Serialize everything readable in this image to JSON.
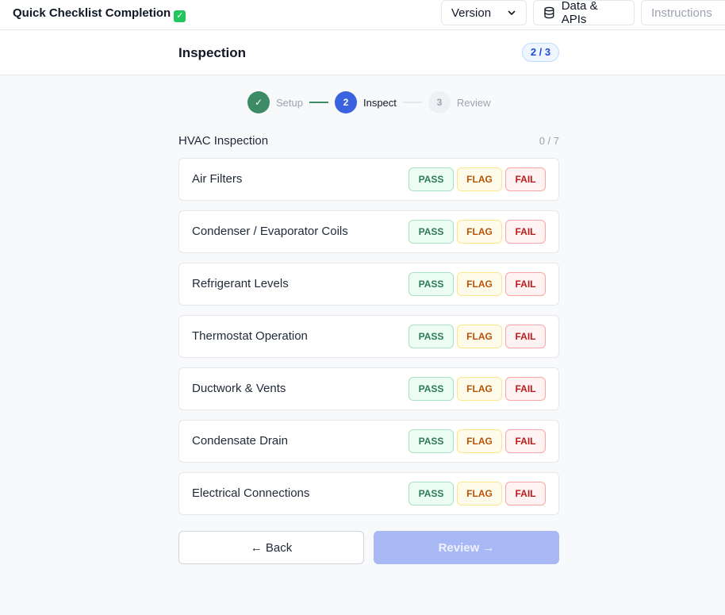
{
  "app": {
    "title": "Quick Checklist Completion",
    "title_emoji": "✓"
  },
  "topbar": {
    "version_label": "Version",
    "data_label": "Data & APIs",
    "instructions_label": "Instructions"
  },
  "page": {
    "title": "Inspection",
    "step_badge": "2 / 3"
  },
  "stepper": {
    "steps": [
      {
        "number": "✓",
        "label": "Setup",
        "state": "done"
      },
      {
        "number": "2",
        "label": "Inspect",
        "state": "active"
      },
      {
        "number": "3",
        "label": "Review",
        "state": "todo"
      }
    ]
  },
  "section": {
    "title": "HVAC Inspection",
    "count": "0 / 7"
  },
  "options": {
    "pass": "PASS",
    "flag": "FLAG",
    "fail": "FAIL"
  },
  "items": [
    {
      "label": "Air Filters"
    },
    {
      "label": "Condenser / Evaporator Coils"
    },
    {
      "label": "Refrigerant Levels"
    },
    {
      "label": "Thermostat Operation"
    },
    {
      "label": "Ductwork & Vents"
    },
    {
      "label": "Condensate Drain"
    },
    {
      "label": "Electrical Connections"
    }
  ],
  "footer": {
    "back_label": "← Back",
    "review_label": "Review →"
  },
  "colors": {
    "accent": "#3b63e0",
    "done": "#3d8b64",
    "review_disabled": "#a8b8f5"
  }
}
